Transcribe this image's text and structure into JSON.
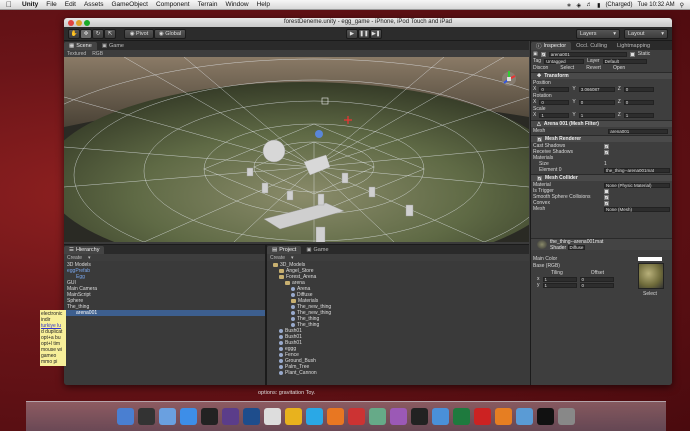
{
  "menubar": {
    "app": "Unity",
    "items": [
      "File",
      "Edit",
      "Assets",
      "GameObject",
      "Component",
      "Terrain",
      "Window",
      "Help"
    ],
    "battery": "(Charged)",
    "clock": "Tue 10:32 AM"
  },
  "window": {
    "title": "forestDeneme.unity - egg_game - iPhone, iPod Touch and iPad"
  },
  "toolbar": {
    "pivot": "Pivot",
    "global": "Global",
    "layers": "Layers",
    "layout": "Layout"
  },
  "scene": {
    "tabs": [
      "Scene",
      "Game"
    ],
    "subbar": [
      "Textured",
      "RGB"
    ]
  },
  "inspector": {
    "tabs": [
      "Inspector",
      "Occl. Culling",
      "Lightmapping"
    ],
    "object_name": "arena001",
    "static": "Static",
    "tag_label": "Tag",
    "tag_value": "Untagged",
    "layer_label": "Layer",
    "layer_value": "Default",
    "prefab_label": "Discon",
    "prefab_select": "Select",
    "prefab_revert": "Revert",
    "prefab_open": "Open",
    "transform": "Transform",
    "position": "Position",
    "pos": {
      "x": "0",
      "y": "3.066087",
      "z": "0"
    },
    "rotation": "Rotation",
    "rot": {
      "x": "0",
      "y": "0",
      "z": "0"
    },
    "scale": "Scale",
    "scl": {
      "x": "1",
      "y": "1",
      "z": "1"
    },
    "mesh_filter": "Arena 001 (Mesh Filter)",
    "mesh_label": "Mesh",
    "mesh_value": "arena001",
    "mesh_renderer": "Mesh Renderer",
    "cast_shadows": "Cast Shadows",
    "receive_shadows": "Receive Shadows",
    "materials": "Materials",
    "size_label": "Size",
    "size_value": "1",
    "element0_label": "Element 0",
    "element0_value": "the_thing--arena001mat",
    "mesh_collider": "Mesh Collider",
    "material_label": "Material",
    "material_value": "None (Physic Material)",
    "is_trigger": "Is Trigger",
    "smooth_sphere": "Smooth Sphere Collisions",
    "convex": "Convex",
    "mesh2_label": "Mesh",
    "mesh2_value": "None (Mesh)",
    "mat_name": "the_thing--arena001mat",
    "shader_label": "Shader",
    "shader_value": "Diffuse",
    "main_color": "Main Color",
    "base_rgb": "Base (RGB)",
    "tiling": "Tiling",
    "offset": "Offset",
    "tiling_x": "1",
    "tiling_y": "1",
    "offset_x": "0",
    "offset_y": "0",
    "select": "Select"
  },
  "hierarchy": {
    "tab": "Hierarchy",
    "create": "Create",
    "items": [
      "3D Models",
      "eggPrefab",
      "Egg",
      "GUI",
      "Main Camera",
      "MainScript",
      "Sphere",
      "The_thing",
      "arena001"
    ]
  },
  "project": {
    "tabs": [
      "Project",
      "Game"
    ],
    "create": "Create",
    "items": [
      "3D_Models",
      "Angel_Store",
      "Forest_Arena",
      "arena",
      "Arena",
      "Diffuse",
      "Materials",
      "The_new_thing",
      "The_new_thing",
      "The_thing",
      "The_thing",
      "Bush01",
      "Bush01",
      "Bush01",
      "eggg",
      "Fence",
      "Ground_Bush",
      "Palm_Tree",
      "Plant_Cannon"
    ]
  },
  "sticky": {
    "lines": [
      "electronic",
      "indir",
      "",
      "turkiye lu",
      "",
      "d duplicat",
      "opt+a bu",
      "opt+l tim",
      "mouse wi",
      "gameo",
      "mmo pi"
    ]
  },
  "bottom_text": "options: gravitation Toy.",
  "dock": [
    "Finder",
    "Dashboard",
    "Mail",
    "Safari",
    "Unity",
    "After Effects",
    "Photoshop",
    "iCal",
    "Chrome",
    "Skype",
    "Firefox",
    "Calendar",
    "Preview",
    "iTunes",
    "Unity",
    "Pages",
    "Excel",
    "FileZilla",
    "VLC",
    "Mail",
    "Terminal",
    "Trash"
  ],
  "colors": {
    "accent": "#3d74c6",
    "selected": "#3d5f8f"
  }
}
